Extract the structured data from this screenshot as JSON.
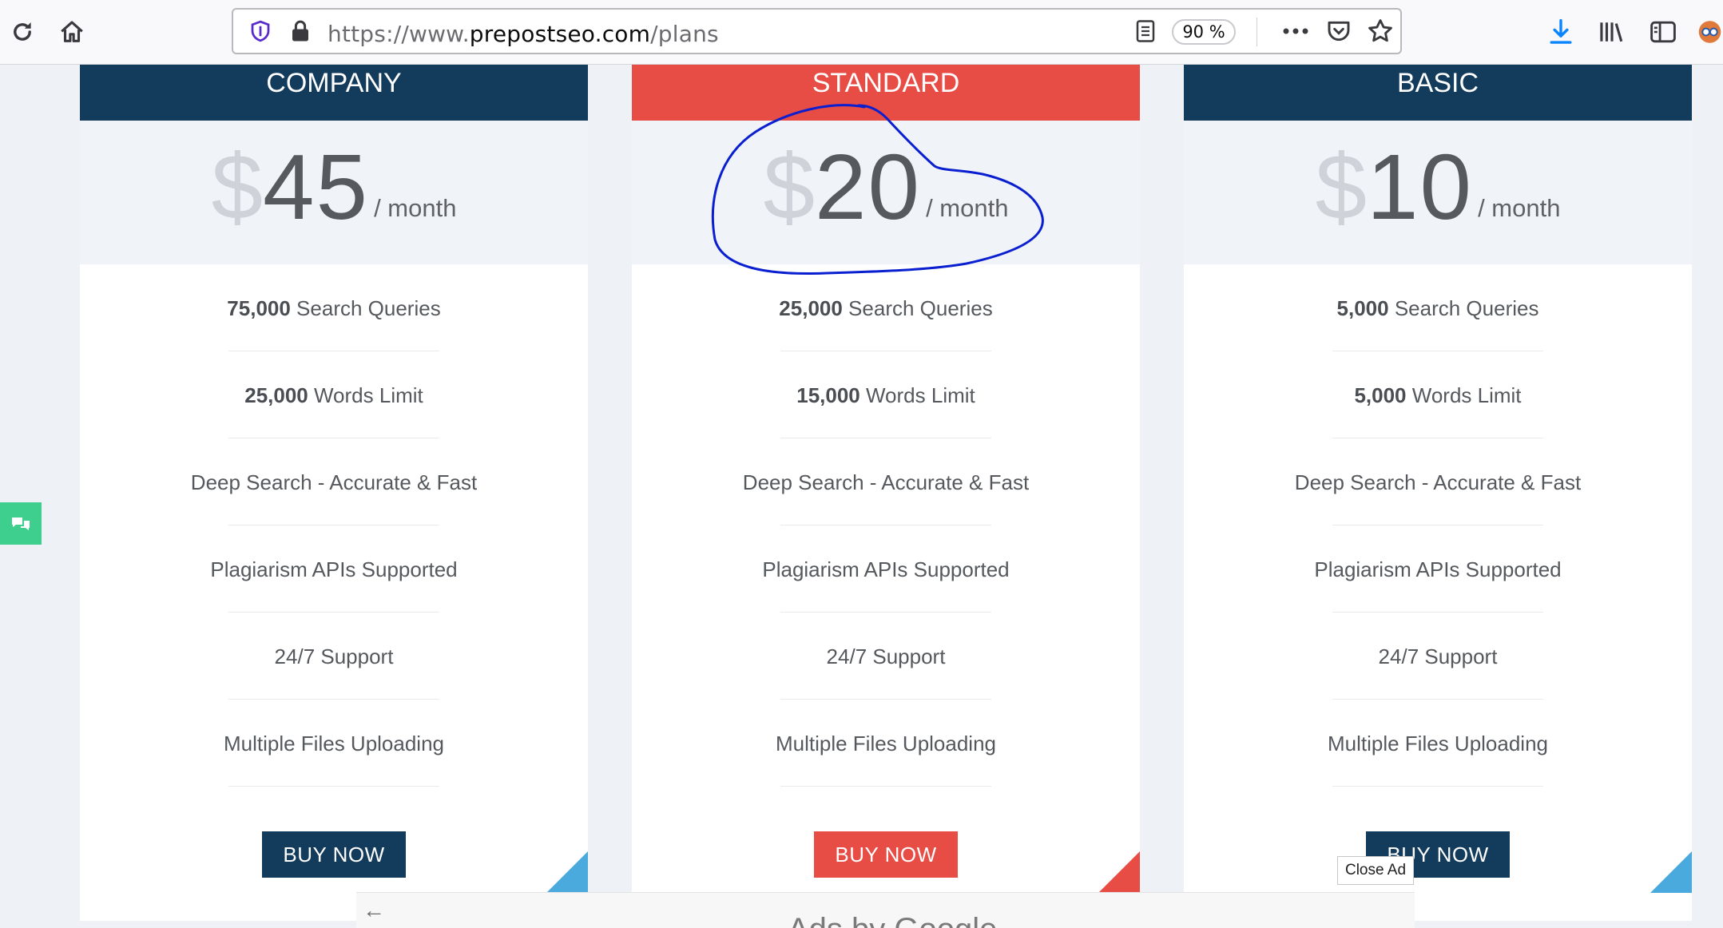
{
  "browser": {
    "url_scheme": "https://www.",
    "url_host": "prepostseo.com",
    "url_path": "/plans",
    "zoom": "90 %"
  },
  "colors": {
    "navy": "#133b5c",
    "red": "#e74c45",
    "chat_green": "#3ecf8e",
    "corner_blue": "#4aa9dd"
  },
  "plans": [
    {
      "name": "COMPANY",
      "currency": "$",
      "amount": "45",
      "period": "/ month",
      "features": [
        {
          "bold": "75,000",
          "text": " Search Queries"
        },
        {
          "bold": "25,000",
          "text": " Words Limit"
        },
        {
          "bold": "",
          "text": "Deep Search - Accurate & Fast"
        },
        {
          "bold": "",
          "text": "Plagiarism APIs Supported"
        },
        {
          "bold": "",
          "text": "24/7 Support"
        },
        {
          "bold": "",
          "text": "Multiple Files Uploading"
        }
      ],
      "button": "BUY NOW"
    },
    {
      "name": "STANDARD",
      "currency": "$",
      "amount": "20",
      "period": "/ month",
      "features": [
        {
          "bold": "25,000",
          "text": " Search Queries"
        },
        {
          "bold": "15,000",
          "text": " Words Limit"
        },
        {
          "bold": "",
          "text": "Deep Search - Accurate & Fast"
        },
        {
          "bold": "",
          "text": "Plagiarism APIs Supported"
        },
        {
          "bold": "",
          "text": "24/7 Support"
        },
        {
          "bold": "",
          "text": "Multiple Files Uploading"
        }
      ],
      "button": "BUY NOW"
    },
    {
      "name": "BASIC",
      "currency": "$",
      "amount": "10",
      "period": "/ month",
      "features": [
        {
          "bold": "5,000",
          "text": " Search Queries"
        },
        {
          "bold": "5,000",
          "text": " Words Limit"
        },
        {
          "bold": "",
          "text": "Deep Search - Accurate & Fast"
        },
        {
          "bold": "",
          "text": "Plagiarism APIs Supported"
        },
        {
          "bold": "",
          "text": "24/7 Support"
        },
        {
          "bold": "",
          "text": "Multiple Files Uploading"
        }
      ],
      "button": "BUY NOW"
    }
  ],
  "ad": {
    "close_label": "Close Ad",
    "back_icon": "arrow-left-icon",
    "label": "Ads by Google"
  }
}
